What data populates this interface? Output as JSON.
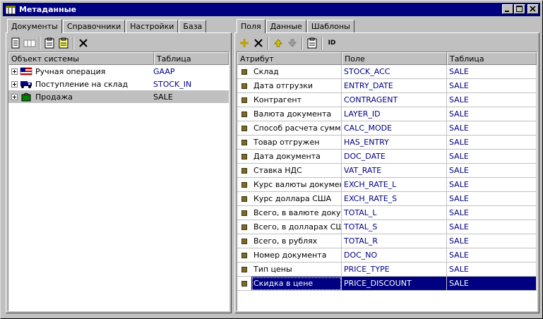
{
  "window": {
    "title": "Метаданные"
  },
  "left": {
    "tabs": [
      "Документы",
      "Справочники",
      "Настройки",
      "База"
    ],
    "columns": [
      "Объект системы",
      "Таблица"
    ],
    "rows": [
      {
        "name": "Ручная операция",
        "table": "GAAP",
        "icon": "flag-icon"
      },
      {
        "name": "Поступление на склад",
        "table": "STOCK_IN",
        "icon": "truck-icon"
      },
      {
        "name": "Продажа",
        "table": "SALE",
        "icon": "bag-icon"
      }
    ]
  },
  "right": {
    "tabs": [
      "Поля",
      "Данные",
      "Шаблоны"
    ],
    "toolbar": {
      "id_label": "ID"
    },
    "columns": [
      "Атрибут",
      "Поле",
      "Таблица"
    ],
    "rows": [
      {
        "attr": "Склад",
        "field": "STOCK_ACC",
        "table": "SALE"
      },
      {
        "attr": "Дата отгрузки",
        "field": "ENTRY_DATE",
        "table": "SALE"
      },
      {
        "attr": "Контрагент",
        "field": "CONTRAGENT",
        "table": "SALE"
      },
      {
        "attr": "Валюта документа",
        "field": "LAYER_ID",
        "table": "SALE"
      },
      {
        "attr": "Способ расчета сумм",
        "field": "CALC_MODE",
        "table": "SALE"
      },
      {
        "attr": "Товар отгружен",
        "field": "HAS_ENTRY",
        "table": "SALE"
      },
      {
        "attr": "Дата документа",
        "field": "DOC_DATE",
        "table": "SALE"
      },
      {
        "attr": "Ставка НДС",
        "field": "VAT_RATE",
        "table": "SALE"
      },
      {
        "attr": "Курс валюты документа",
        "field": "EXCH_RATE_L",
        "table": "SALE"
      },
      {
        "attr": "Курс доллара США",
        "field": "EXCH_RATE_S",
        "table": "SALE"
      },
      {
        "attr": "Всего, в валюте документа",
        "field": "TOTAL_L",
        "table": "SALE"
      },
      {
        "attr": "Всего, в долларах США",
        "field": "TOTAL_S",
        "table": "SALE"
      },
      {
        "attr": "Всего, в рублях",
        "field": "TOTAL_R",
        "table": "SALE"
      },
      {
        "attr": "Номер документа",
        "field": "DOC_NO",
        "table": "SALE"
      },
      {
        "attr": "Тип цены",
        "field": "PRICE_TYPE",
        "table": "SALE"
      },
      {
        "attr": "Скидка в цене",
        "field": "PRICE_DISCOUNT",
        "table": "SALE"
      }
    ]
  }
}
